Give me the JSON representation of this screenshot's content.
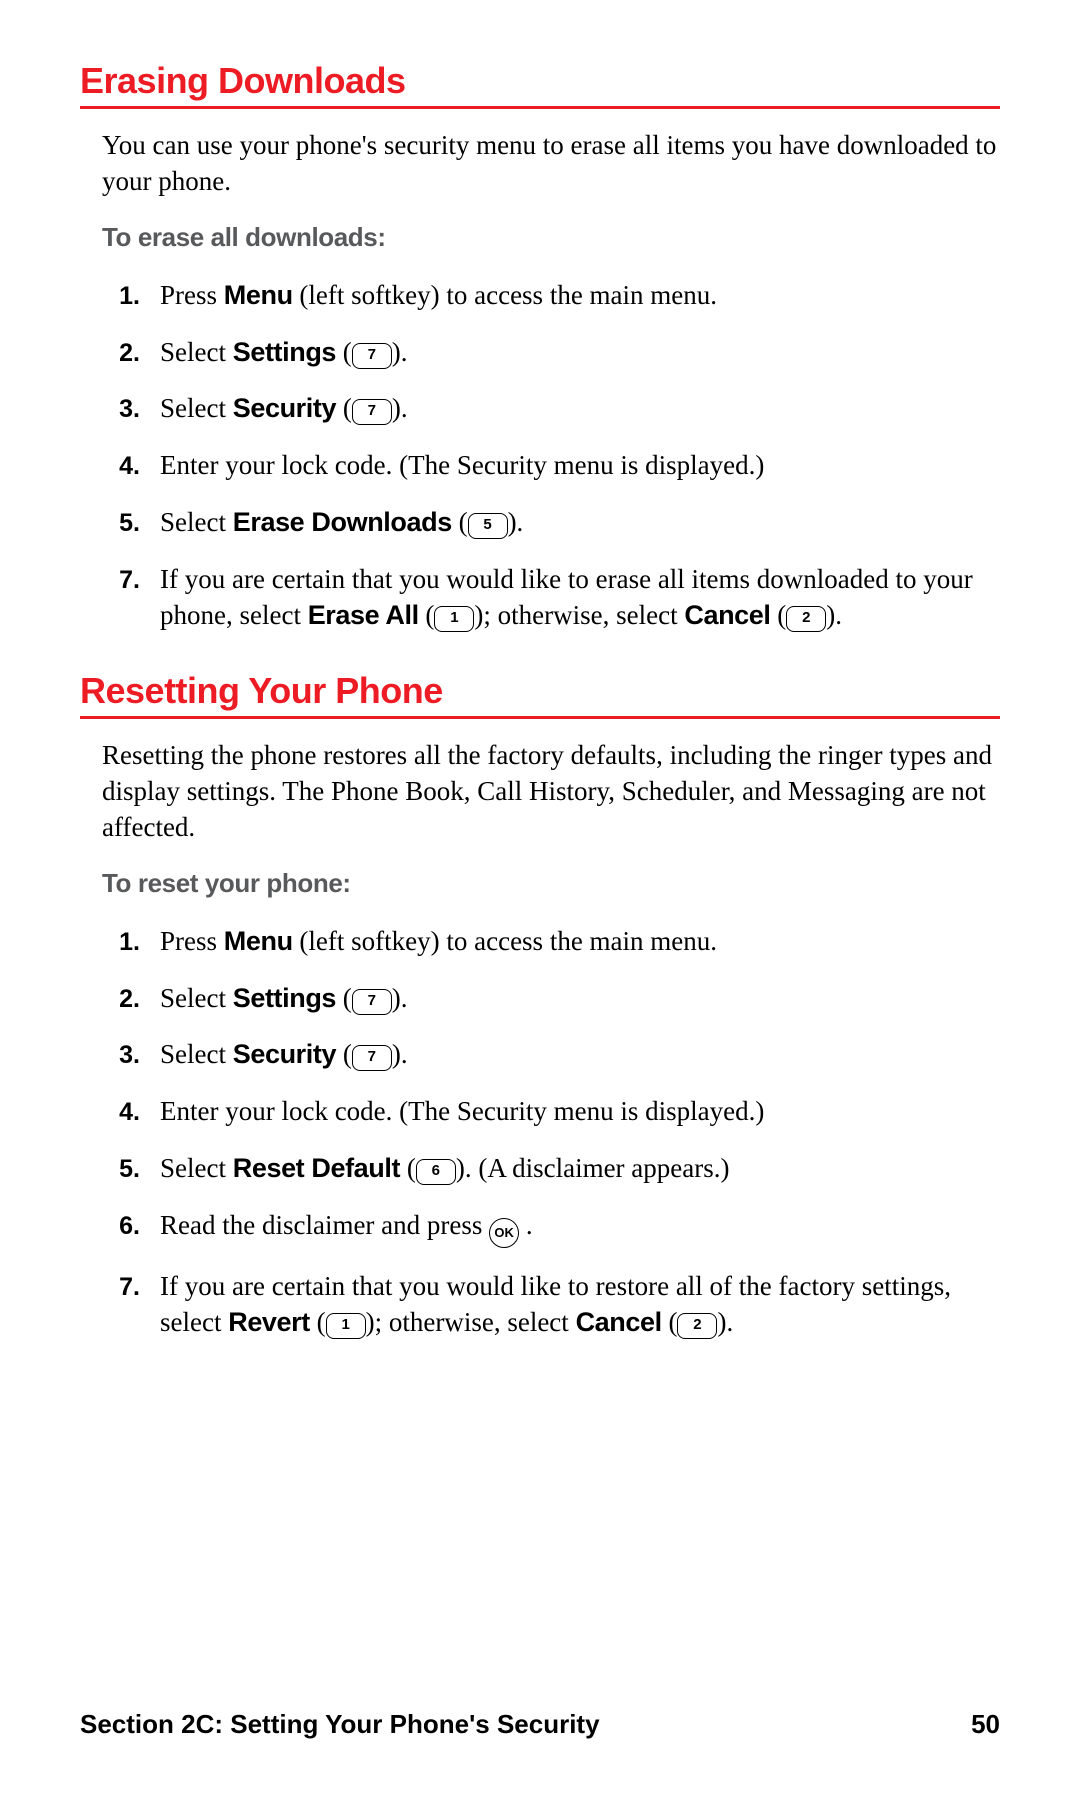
{
  "section1": {
    "heading": "Erasing Downloads",
    "intro": "You can use your phone's security menu to erase all items you have downloaded to your phone.",
    "label": "To erase all downloads:",
    "steps": [
      {
        "n": "1.",
        "pre": "Press ",
        "b1": "Menu",
        "post1": " (left softkey) to access the main menu."
      },
      {
        "n": "2.",
        "pre": "Select ",
        "b1": "Settings",
        "post1": " (",
        "key1": "7",
        "post2": ")."
      },
      {
        "n": "3.",
        "pre": "Select ",
        "b1": "Security",
        "post1": " (",
        "key1": "7",
        "post2": ")."
      },
      {
        "n": "4.",
        "pre": "Enter your lock code. (The Security menu is displayed.)"
      },
      {
        "n": "5.",
        "pre": "Select ",
        "b1": "Erase Downloads",
        "post1": " (",
        "key1": "5",
        "post2": ")."
      },
      {
        "n": "7.",
        "pre": "If you are certain that you would like to erase all items downloaded to your phone, select ",
        "b1": "Erase All",
        "post1": " (",
        "key1": "1",
        "post2": "); otherwise, select ",
        "b2": "Cancel",
        "post3": " (",
        "key2": "2",
        "post4": ")."
      }
    ]
  },
  "section2": {
    "heading": "Resetting Your Phone",
    "intro": "Resetting the phone restores all the factory defaults, including the ringer types and display settings. The Phone Book, Call History, Scheduler, and Messaging are not affected.",
    "label": "To reset your phone:",
    "steps": [
      {
        "n": "1.",
        "pre": "Press ",
        "b1": "Menu",
        "post1": " (left softkey) to access the main menu."
      },
      {
        "n": "2.",
        "pre": "Select ",
        "b1": "Settings",
        "post1": " (",
        "key1": "7",
        "post2": ")."
      },
      {
        "n": "3.",
        "pre": "Select ",
        "b1": "Security",
        "post1": " (",
        "key1": "7",
        "post2": ")."
      },
      {
        "n": "4.",
        "pre": "Enter your lock code. (The Security menu is displayed.)"
      },
      {
        "n": "5.",
        "pre": "Select ",
        "b1": "Reset Default",
        "post1": " (",
        "key1": "6",
        "post2": "). (A disclaimer appears.)"
      },
      {
        "n": "6.",
        "pre": "Read the disclaimer and press ",
        "ok": "OK",
        "post1": " ."
      },
      {
        "n": "7.",
        "pre": "If you are certain that you would like to restore all of the factory settings, select ",
        "b1": "Revert",
        "post1": " (",
        "key1": "1",
        "post2": "); otherwise, select ",
        "b2": "Cancel",
        "post3": " (",
        "key2": "2",
        "post4": ")."
      }
    ]
  },
  "footer": {
    "section": "Section 2C: Setting Your Phone's Security",
    "page": "50"
  }
}
